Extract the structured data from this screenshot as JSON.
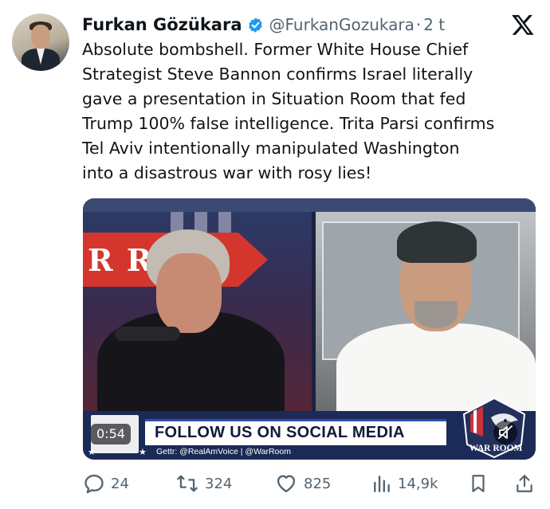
{
  "author": {
    "name": "Furkan Gözükara",
    "handle": "@FurkanGozukara",
    "separator": "·",
    "time": "2 t"
  },
  "tweet": {
    "text": "Absolute bombshell. Former White House Chief\nStrategist Steve Bannon confirms Israel literally\ngave a presentation in Situation Room that fed\nTrump 100% false intelligence. Trita Parsi confirms\nTel Aviv intentionally manipulated Washington\ninto a disastrous war with rosy lies!"
  },
  "media": {
    "duration": "0:54",
    "banner_left": "R RO M",
    "lower_third_title": "FOLLOW US ON SOCIAL MEDIA",
    "lower_third_subtitle": "Gettr: @RealAmVoice | @WarRoom",
    "logo_text": "WAR ROOM",
    "mute_icon": "speaker-muted-icon"
  },
  "actions": {
    "replies": "24",
    "reposts": "324",
    "likes": "825",
    "views": "14,9k"
  },
  "icons": {
    "verified": "verified-badge-icon",
    "platform": "x-logo-icon",
    "reply": "reply-icon",
    "repost": "repost-icon",
    "like": "heart-icon",
    "views": "views-icon",
    "bookmark": "bookmark-icon",
    "share": "share-icon"
  },
  "colors": {
    "verified": "#1d9bf0",
    "secondary_text": "#536471",
    "primary_text": "#0f1419"
  }
}
